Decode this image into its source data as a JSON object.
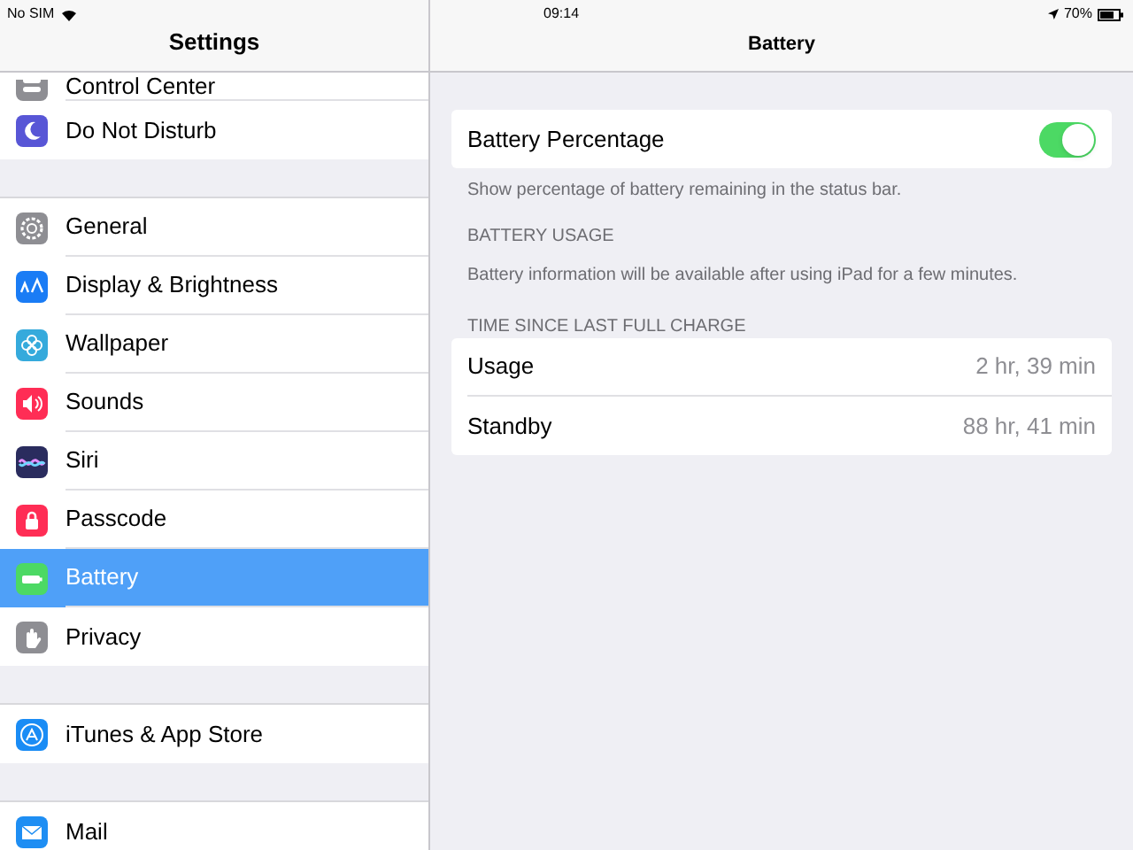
{
  "status_bar": {
    "carrier": "No SIM",
    "time": "09:14",
    "battery_percent": "70%"
  },
  "sidebar": {
    "title": "Settings",
    "groups": [
      [
        {
          "label": "Control Center",
          "kind": "switches",
          "selected": false
        },
        {
          "label": "Do Not Disturb",
          "kind": "moon",
          "selected": false
        }
      ],
      [
        {
          "label": "General",
          "kind": "gear",
          "selected": false
        },
        {
          "label": "Display & Brightness",
          "kind": "textsize",
          "selected": false
        },
        {
          "label": "Wallpaper",
          "kind": "flower",
          "selected": false
        },
        {
          "label": "Sounds",
          "kind": "speaker",
          "selected": false
        },
        {
          "label": "Siri",
          "kind": "siri",
          "selected": false
        },
        {
          "label": "Passcode",
          "kind": "lock",
          "selected": false
        },
        {
          "label": "Battery",
          "kind": "battery",
          "selected": true
        },
        {
          "label": "Privacy",
          "kind": "hand",
          "selected": false
        }
      ],
      [
        {
          "label": "iTunes & App Store",
          "kind": "appstore",
          "selected": false
        }
      ],
      [
        {
          "label": "Mail",
          "kind": "mail",
          "selected": false
        }
      ]
    ]
  },
  "detail": {
    "title": "Battery",
    "toggle": {
      "label": "Battery Percentage",
      "on": true
    },
    "toggle_footer": "Show percentage of battery remaining in the status bar.",
    "usage_header": "BATTERY USAGE",
    "usage_info": "Battery information will be available after using iPad for a few minutes.",
    "charge_header": "TIME SINCE LAST FULL CHARGE",
    "charge_rows": [
      {
        "label": "Usage",
        "value": "2 hr, 39 min"
      },
      {
        "label": "Standby",
        "value": "88 hr, 41 min"
      }
    ]
  }
}
